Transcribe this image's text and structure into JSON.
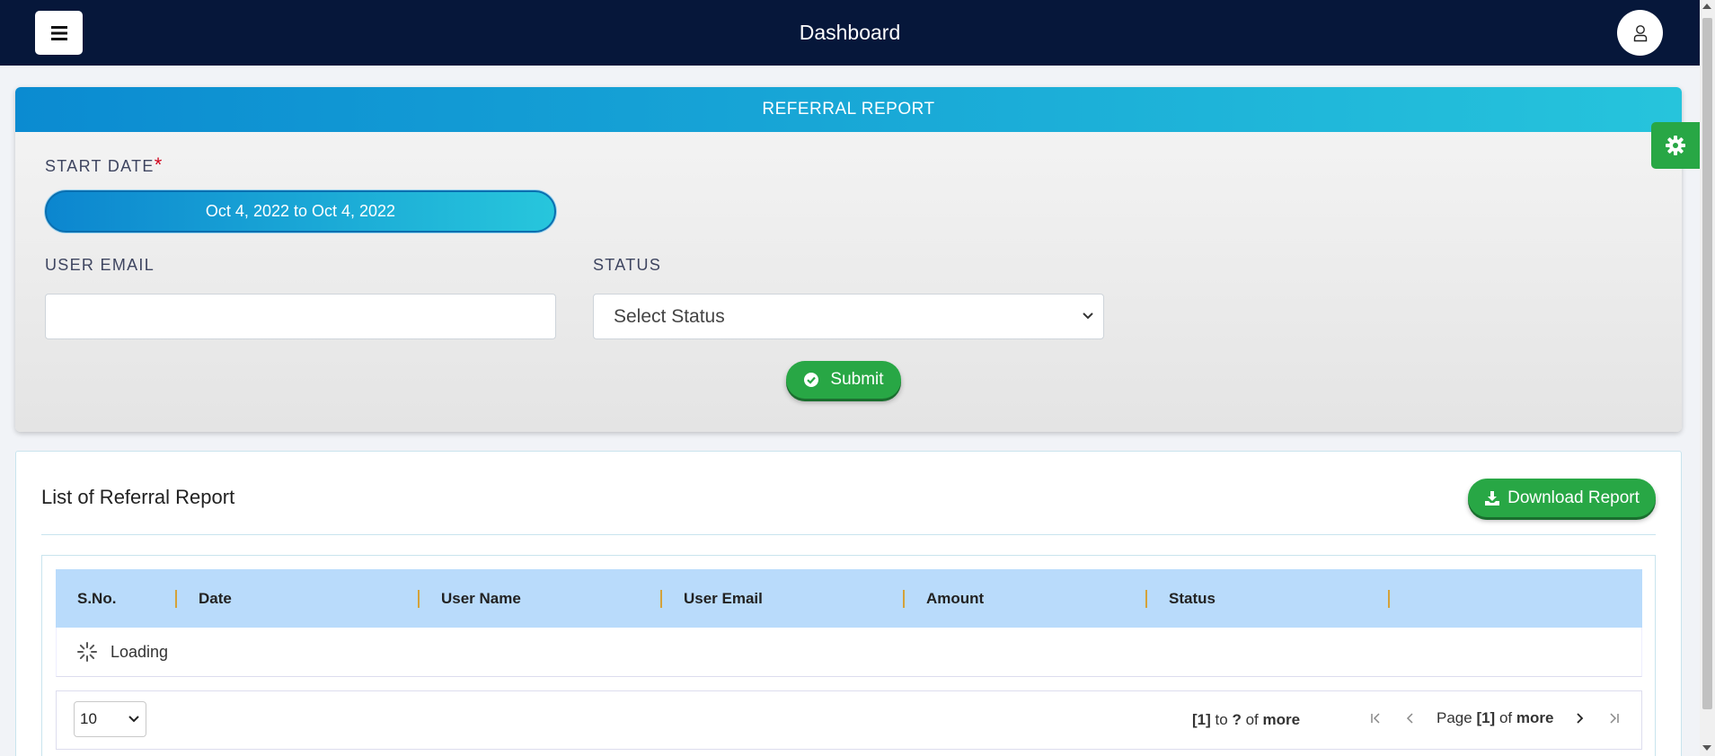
{
  "header": {
    "title": "Dashboard"
  },
  "filter": {
    "card_title": "REFERRAL REPORT",
    "start_date_label": "START DATE",
    "required_mark": "*",
    "date_range_value": "Oct 4, 2022 to Oct 4, 2022",
    "user_email_label": "USER EMAIL",
    "user_email_value": "",
    "status_label": "STATUS",
    "status_selected": "Select Status",
    "submit_label": "Submit"
  },
  "list": {
    "title": "List of Referral Report",
    "download_label": "Download Report",
    "columns": [
      "S.No.",
      "Date",
      "User Name",
      "User Email",
      "Amount",
      "Status",
      ""
    ],
    "loading_text": "Loading"
  },
  "pagination": {
    "page_size": "10",
    "range_from": "[1]",
    "range_to_word": "to",
    "range_to": "?",
    "range_of_word": "of",
    "range_total": "more",
    "page_word": "Page",
    "current_page": "[1]",
    "page_of_word": "of",
    "page_total": "more"
  },
  "colors": {
    "topbar": "#06173a",
    "accent_blue": "#0b8bd1",
    "success_green": "#28a745",
    "table_header": "#b9dbfb"
  },
  "icons": {
    "menu": "hamburger-icon",
    "profile": "user-icon",
    "settings": "gear-icon",
    "submit": "check-circle-icon",
    "download": "download-icon",
    "loading": "spinner-icon"
  }
}
